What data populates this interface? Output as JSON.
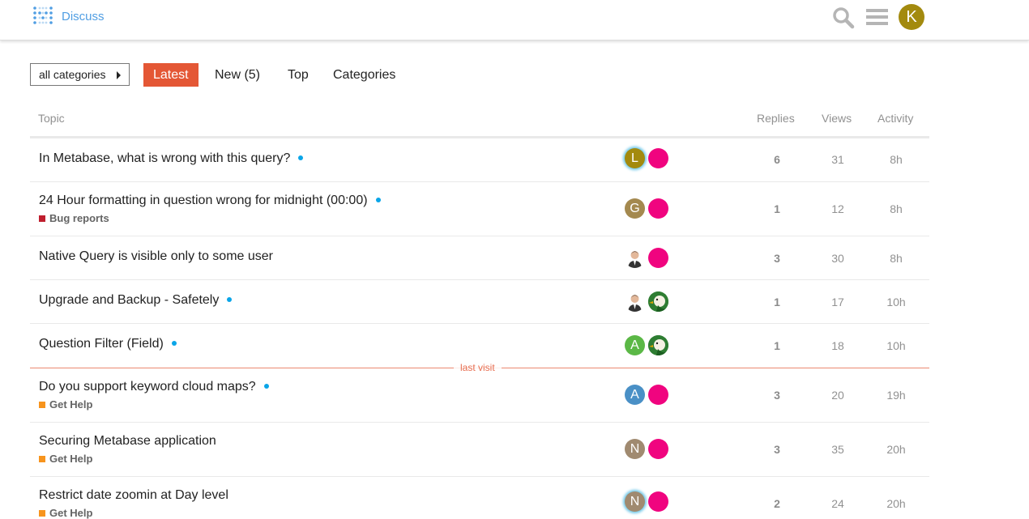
{
  "header": {
    "brand": "Discuss",
    "user_initial": "K",
    "user_color": "#a38a0e"
  },
  "nav": {
    "category_dropdown": "all categories",
    "tabs": [
      {
        "label": "Latest",
        "active": true
      },
      {
        "label": "New (5)"
      },
      {
        "label": "Top"
      },
      {
        "label": "Categories"
      }
    ]
  },
  "table": {
    "headers": {
      "topic": "Topic",
      "replies": "Replies",
      "views": "Views",
      "activity": "Activity"
    },
    "last_visit": "last visit",
    "rows": [
      {
        "title": "In Metabase, what is wrong with this query?",
        "unread": true,
        "category": null,
        "posters": [
          {
            "initial": "L",
            "color": "#a38a0e",
            "latest": true
          },
          {
            "initial": "",
            "color": "#f0047f"
          }
        ],
        "replies": "6",
        "views": "31",
        "activity": "8h"
      },
      {
        "title": "24 Hour formatting in question wrong for midnight (00:00)",
        "unread": true,
        "category": {
          "name": "Bug reports",
          "color": "#bf1e2e"
        },
        "posters": [
          {
            "initial": "G",
            "color": "#a4894f"
          },
          {
            "initial": "",
            "color": "#f0047f"
          }
        ],
        "replies": "1",
        "views": "12",
        "activity": "8h"
      },
      {
        "title": "Native Query is visible only to some user",
        "unread": false,
        "category": null,
        "posters": [
          {
            "initial": "",
            "color": "#ffffff",
            "photo": "person"
          },
          {
            "initial": "",
            "color": "#f0047f"
          }
        ],
        "replies": "3",
        "views": "30",
        "activity": "8h"
      },
      {
        "title": "Upgrade and Backup - Safetely",
        "unread": true,
        "category": null,
        "posters": [
          {
            "initial": "",
            "color": "#ffffff",
            "photo": "person"
          },
          {
            "initial": "",
            "color": "#2e7d32",
            "photo": "bird"
          }
        ],
        "replies": "1",
        "views": "17",
        "activity": "10h"
      },
      {
        "title": "Question Filter (Field)",
        "unread": true,
        "category": null,
        "posters": [
          {
            "initial": "A",
            "color": "#5bb846"
          },
          {
            "initial": "",
            "color": "#2e7d32",
            "photo": "bird"
          }
        ],
        "replies": "1",
        "views": "18",
        "activity": "10h"
      },
      {
        "title": "Do you support keyword cloud maps?",
        "unread": true,
        "category": {
          "name": "Get Help",
          "color": "#f7941d"
        },
        "posters": [
          {
            "initial": "A",
            "color": "#4a90c6"
          },
          {
            "initial": "",
            "color": "#f0047f"
          }
        ],
        "replies": "3",
        "views": "20",
        "activity": "19h"
      },
      {
        "title": "Securing Metabase application",
        "unread": false,
        "category": {
          "name": "Get Help",
          "color": "#f7941d"
        },
        "posters": [
          {
            "initial": "N",
            "color": "#a08a70"
          },
          {
            "initial": "",
            "color": "#f0047f"
          }
        ],
        "replies": "3",
        "views": "35",
        "activity": "20h"
      },
      {
        "title": "Restrict date zoomin at Day level",
        "unread": false,
        "category": {
          "name": "Get Help",
          "color": "#f7941d"
        },
        "posters": [
          {
            "initial": "N",
            "color": "#a08a70",
            "latest": true
          },
          {
            "initial": "",
            "color": "#f0047f"
          }
        ],
        "replies": "2",
        "views": "24",
        "activity": "20h"
      }
    ]
  }
}
